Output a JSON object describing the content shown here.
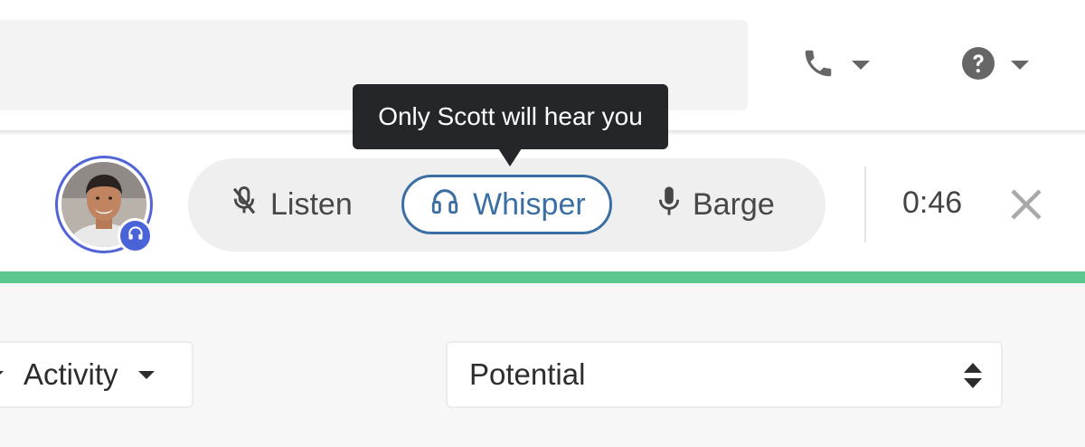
{
  "topbar": {
    "phone_icon": "phone-icon",
    "help_icon": "help-icon"
  },
  "call": {
    "avatar_badge_icon": "headset-icon",
    "modes": {
      "listen_label": "Listen",
      "whisper_label": "Whisper",
      "barge_label": "Barge",
      "active": "Whisper"
    },
    "timer": "0:46",
    "tooltip": "Only Scott will hear you"
  },
  "filters": {
    "activity_label": "Activity",
    "potential_value": "Potential"
  },
  "colors": {
    "whisper_accent": "#3b6fa3",
    "badge": "#4b63d9",
    "status_line": "#5cc88f",
    "tooltip_bg": "#24262a"
  }
}
